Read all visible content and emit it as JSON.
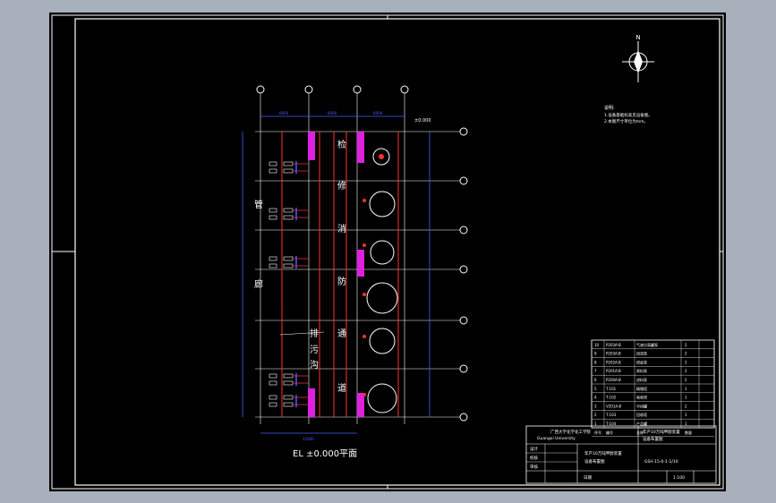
{
  "drawing": {
    "plan_title": "EL ±0.000平面",
    "elevation_mark": "±0.000",
    "vertical_labels": [
      "检",
      "修",
      "消",
      "防",
      "通",
      "道"
    ],
    "pipe_rack_labels": [
      "管",
      "廊"
    ],
    "trench_labels": [
      "排",
      "污",
      "沟"
    ],
    "north_letter": "N"
  },
  "notes": {
    "heading": "说明:",
    "lines": [
      "1.设备基础标高见设备图。",
      "2.本图尺寸单位为mm。"
    ]
  },
  "parts_table": {
    "header": [
      "序号",
      "编号",
      "名称",
      "数量"
    ],
    "rows": [
      [
        "10",
        "P203A-B",
        "气液分离罐泵",
        "2"
      ],
      [
        "9",
        "P203A-B",
        "回流泵",
        "2"
      ],
      [
        "8",
        "P202A-B",
        "塔底泵",
        "2"
      ],
      [
        "7",
        "P201A-B",
        "原料泵",
        "2"
      ],
      [
        "6",
        "P200A-B",
        "进料泵",
        "2"
      ],
      [
        "5",
        "T-101",
        "精馏塔",
        "1"
      ],
      [
        "4",
        "T-102",
        "吸收塔",
        "1"
      ],
      [
        "3",
        "V201A-B",
        "中间罐",
        "2"
      ],
      [
        "2",
        "T-103",
        "回收塔",
        "1"
      ],
      [
        "1",
        "T-104",
        "产品罐",
        "1"
      ]
    ]
  },
  "title_block": {
    "school": "广西大学化学化工学院",
    "school_en": "Guangxi University",
    "project": "年产10万吨甲醇装置",
    "drawing_name": "设备布置图",
    "drawing_no": "GSH 15-0-1-1/10",
    "scale": "1:100",
    "design_label": "设计",
    "check_label": "校核",
    "approve_label": "审核",
    "date_label": "日期"
  }
}
